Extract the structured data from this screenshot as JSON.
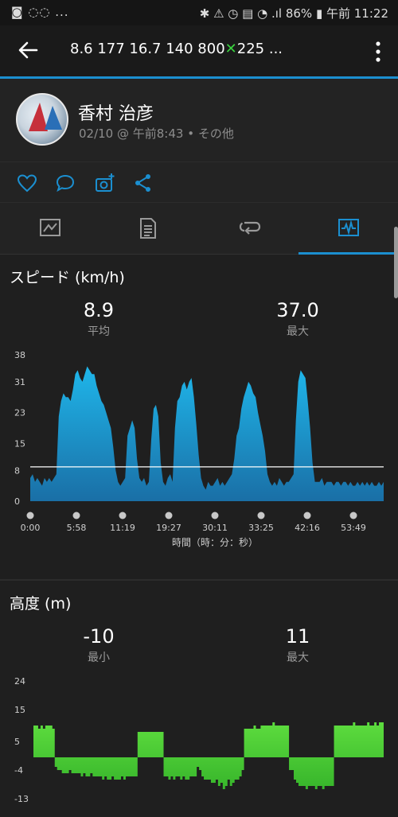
{
  "status_bar": {
    "left_icons": "◙ ◌◌ ...",
    "battery": "86%",
    "time": "午前 11:22"
  },
  "app_bar": {
    "title_prefix": "8.6  177  16.7  140  800",
    "title_suffix": "225 ..."
  },
  "profile": {
    "name": "香村 治彦",
    "meta": "02/10 @ 午前8:43 • その他"
  },
  "tabs": [
    "overview",
    "details",
    "laps",
    "charts"
  ],
  "speed": {
    "title": "スピード (km/h)",
    "avg_value": "8.9",
    "avg_label": "平均",
    "max_value": "37.0",
    "max_label": "最大",
    "x_axis_label": "時間（時：分：秒）"
  },
  "altitude": {
    "title": "高度 (m)",
    "min_value": "-10",
    "min_label": "最小",
    "max_value": "11",
    "max_label": "最大"
  },
  "colors": {
    "accent": "#1b8fd0",
    "speed_fill": "#1ea9de",
    "alt_fill": "#52d33a"
  },
  "chart_data": [
    {
      "type": "area",
      "title": "スピード (km/h)",
      "xlabel": "時間（時：分：秒）",
      "x_ticks": [
        "0:00",
        "5:58",
        "11:19",
        "19:27",
        "30:11",
        "33:25",
        "42:16",
        "53:49"
      ],
      "y_ticks": [
        0,
        8,
        15,
        23,
        31,
        38
      ],
      "ylim": [
        0,
        38
      ],
      "average_line": 8.9,
      "series": [
        {
          "values": [
            6,
            7,
            5,
            6,
            5,
            4,
            6,
            5,
            6,
            5,
            6,
            7,
            22,
            26,
            28,
            27,
            27,
            26,
            29,
            33,
            34,
            32,
            31,
            33,
            35,
            34,
            33,
            33,
            30,
            28,
            26,
            25,
            23,
            21,
            19,
            14,
            8,
            5,
            4,
            5,
            6,
            17,
            19,
            21,
            19,
            11,
            6,
            5,
            6,
            4,
            5,
            16,
            24,
            25,
            22,
            10,
            5,
            4,
            6,
            7,
            5,
            19,
            26,
            27,
            30,
            31,
            29,
            31,
            32,
            27,
            20,
            12,
            6,
            4,
            3,
            5,
            4,
            4,
            5,
            6,
            4,
            5,
            4,
            5,
            6,
            7,
            11,
            17,
            19,
            24,
            27,
            29,
            31,
            30,
            28,
            27,
            23,
            20,
            17,
            13,
            7,
            5,
            4,
            5,
            4,
            6,
            5,
            4,
            5,
            5,
            6,
            7,
            21,
            31,
            34,
            33,
            32,
            26,
            19,
            10,
            5,
            5,
            5,
            6,
            4,
            5,
            5,
            5,
            4,
            5,
            5,
            4,
            5,
            5,
            4,
            5,
            4,
            4,
            5,
            4,
            5,
            4,
            5,
            4,
            5,
            4,
            4,
            5,
            4,
            5
          ]
        }
      ]
    },
    {
      "type": "area",
      "title": "高度 (m)",
      "y_ticks": [
        -13,
        -4,
        5,
        15,
        24
      ],
      "ylim": [
        -13,
        24
      ],
      "series": [
        {
          "values": [
            10,
            10,
            9,
            10,
            9,
            10,
            10,
            10,
            9,
            -3,
            -4,
            -4,
            -5,
            -5,
            -5,
            -4,
            -5,
            -5,
            -5,
            -5,
            -6,
            -5,
            -6,
            -6,
            -5,
            -6,
            -6,
            -6,
            -6,
            -7,
            -6,
            -7,
            -7,
            -6,
            -7,
            -7,
            -7,
            -6,
            -7,
            -6,
            -6,
            -6,
            -6,
            -6,
            8,
            8,
            8,
            8,
            8,
            8,
            8,
            8,
            8,
            8,
            8,
            -6,
            -6,
            -7,
            -6,
            -7,
            -6,
            -6,
            -7,
            -6,
            -7,
            -7,
            -6,
            -6,
            -6,
            -3,
            -4,
            -6,
            -7,
            -7,
            -7,
            -8,
            -8,
            -7,
            -9,
            -8,
            -10,
            -9,
            -7,
            -9,
            -8,
            -7,
            -7,
            -6,
            -4,
            9,
            9,
            9,
            9,
            10,
            9,
            9,
            10,
            10,
            10,
            10,
            10,
            11,
            10,
            10,
            10,
            10,
            10,
            10,
            -4,
            -4,
            -7,
            -8,
            -9,
            -9,
            -9,
            -10,
            -9,
            -9,
            -9,
            -10,
            -9,
            -9,
            -10,
            -9,
            -9,
            -9,
            -9,
            10,
            10,
            10,
            10,
            10,
            10,
            10,
            10,
            11,
            10,
            10,
            10,
            10,
            10,
            11,
            10,
            10,
            11,
            10,
            11,
            11,
            11
          ]
        }
      ]
    }
  ]
}
